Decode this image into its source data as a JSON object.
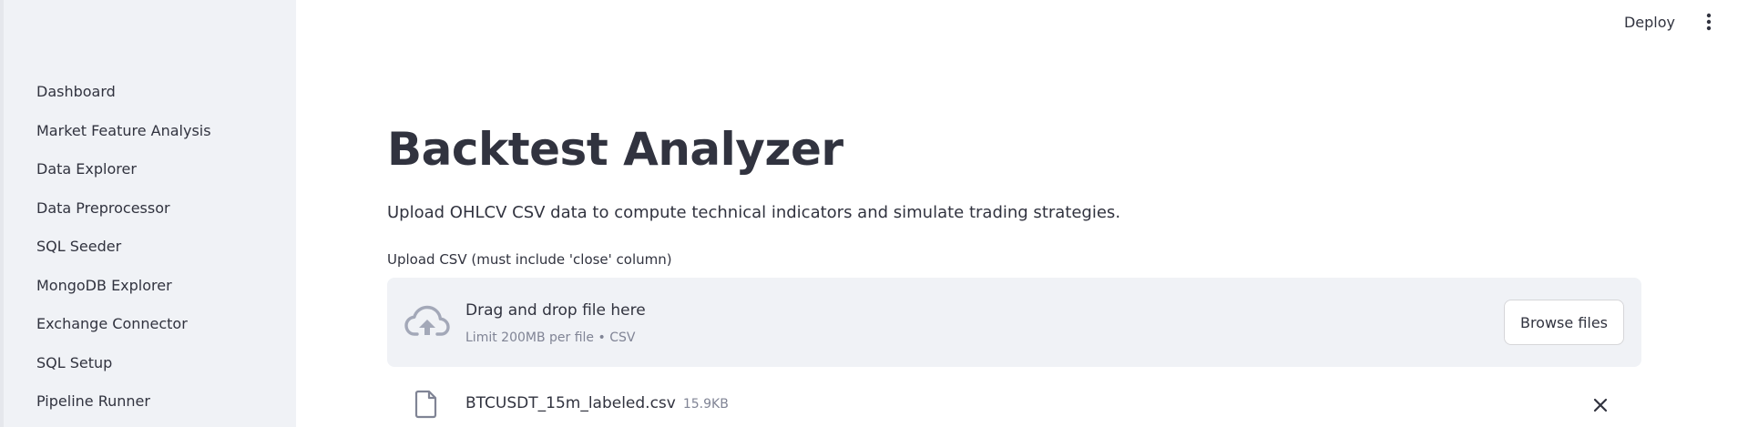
{
  "sidebar": {
    "items": [
      {
        "label": "Dashboard"
      },
      {
        "label": "Market Feature Analysis"
      },
      {
        "label": "Data Explorer"
      },
      {
        "label": "Data Preprocessor"
      },
      {
        "label": "SQL Seeder"
      },
      {
        "label": "MongoDB Explorer"
      },
      {
        "label": "Exchange Connector"
      },
      {
        "label": "SQL Setup"
      },
      {
        "label": "Pipeline Runner"
      }
    ]
  },
  "header": {
    "deploy_label": "Deploy",
    "menu_icon": "vertical-ellipsis-icon"
  },
  "main": {
    "title": "Backtest Analyzer",
    "subtitle": "Upload OHLCV CSV data to compute technical indicators and simulate trading strategies.",
    "uploader": {
      "label": "Upload CSV (must include 'close' column)",
      "dropzone_title": "Drag and drop file here",
      "dropzone_limit": "Limit 200MB per file • CSV",
      "browse_label": "Browse files",
      "upload_icon": "cloud-upload-icon"
    },
    "uploaded_file": {
      "name": "BTCUSDT_15m_labeled.csv",
      "size": "15.9KB",
      "file_icon": "file-icon",
      "remove_icon": "close-icon"
    }
  },
  "colors": {
    "sidebar_bg": "#f0f2f6",
    "text": "#31333f",
    "muted_text": "#808495",
    "dropzone_bg": "#f0f2f6",
    "icon": "#a3a8b8"
  }
}
